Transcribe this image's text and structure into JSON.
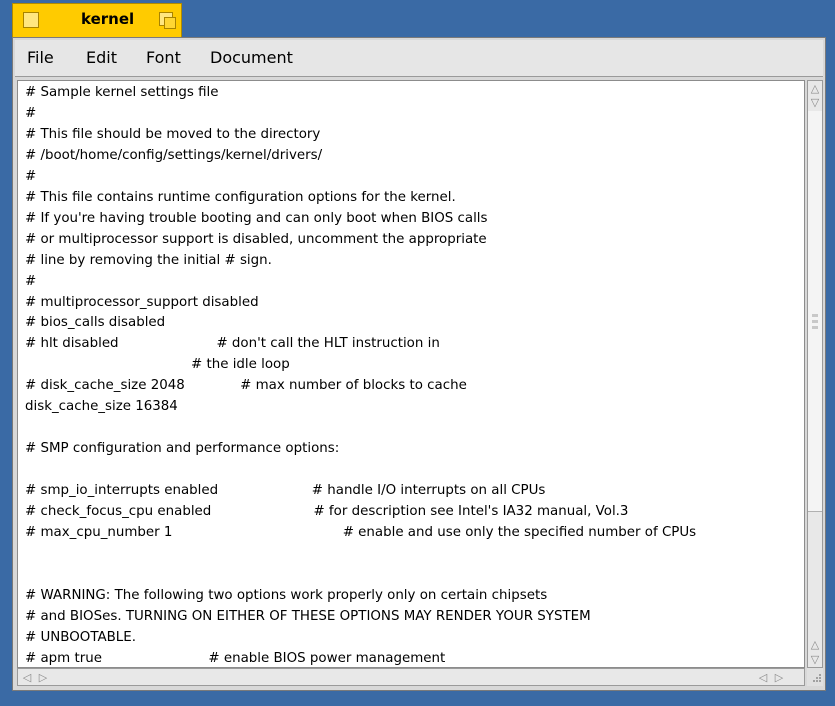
{
  "window": {
    "title": "kernel"
  },
  "menu": [
    "File",
    "Edit",
    "Font",
    "Document"
  ],
  "content": {
    "lines": [
      "# Sample kernel settings file",
      "#",
      "# This file should be moved to the directory",
      "# /boot/home/config/settings/kernel/drivers/",
      "#",
      "# This file contains runtime configuration options for the kernel.",
      "# If you're having trouble booting and can only boot when BIOS calls",
      "# or multiprocessor support is disabled, uncomment the appropriate",
      "# line by removing the initial # sign.",
      "#",
      "# multiprocessor_support disabled",
      "# bios_calls disabled",
      "# hlt disabled                       # don't call the HLT instruction in",
      "                                       # the idle loop",
      "# disk_cache_size 2048             # max number of blocks to cache",
      "disk_cache_size 16384",
      "",
      "# SMP configuration and performance options:",
      "",
      "# smp_io_interrupts enabled                      # handle I/O interrupts on all CPUs",
      "# check_focus_cpu enabled                        # for description see Intel's IA32 manual, Vol.3",
      "# max_cpu_number 1                                        # enable and use only the specified number of CPUs",
      "",
      "",
      "# WARNING: The following two options work properly only on certain chipsets",
      "# and BIOSes. TURNING ON EITHER OF THESE OPTIONS MAY RENDER YOUR SYSTEM",
      "# UNBOOTABLE.",
      "# apm true                         # enable BIOS power management"
    ]
  },
  "icons": {
    "close": "close-box-icon",
    "zoom": "zoom-box-icon",
    "up": "up-arrow-icon",
    "down": "down-arrow-icon",
    "left": "left-arrow-icon",
    "right": "right-arrow-icon",
    "resize": "resize-grip-icon"
  }
}
